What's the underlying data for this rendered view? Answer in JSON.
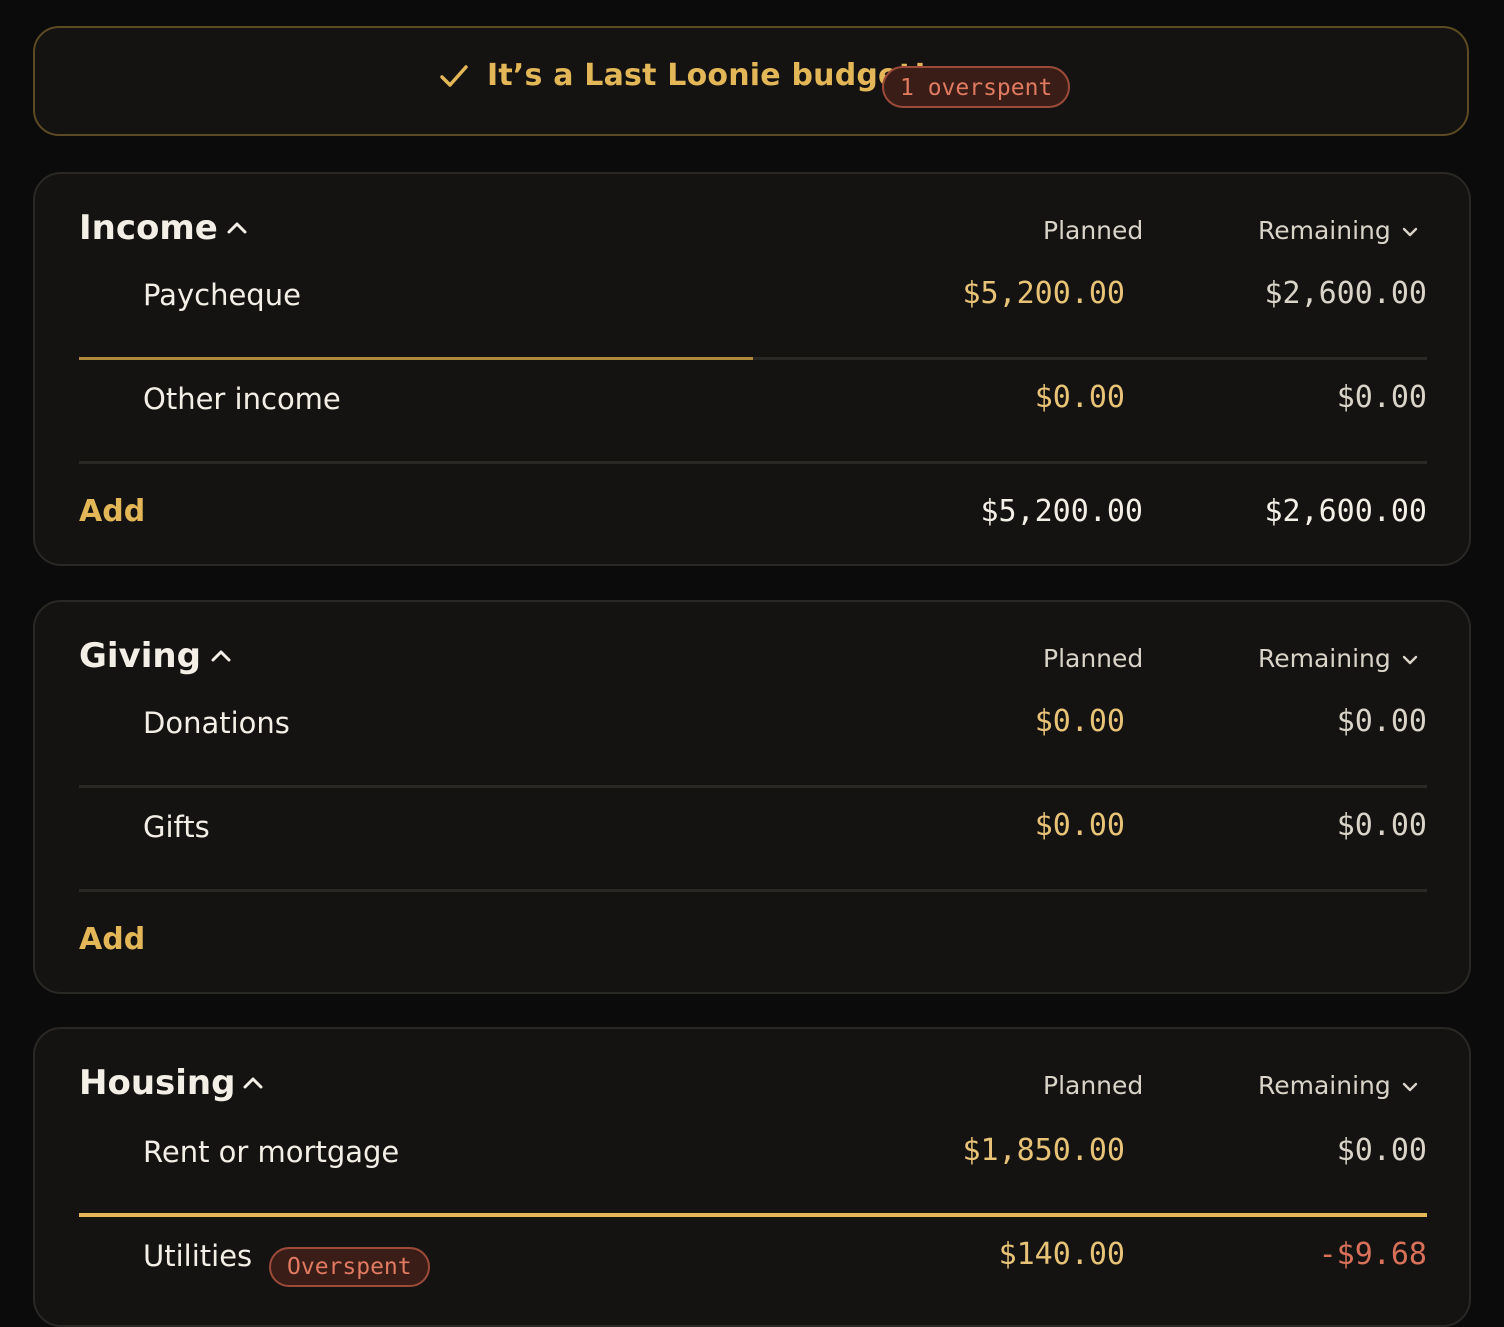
{
  "banner": {
    "icon": "check-icon",
    "title": "It’s a Last Loonie budget!",
    "badge": "1 overspent",
    "accent": "#e3b758"
  },
  "columns": {
    "planned": "Planned",
    "remaining": "Remaining"
  },
  "groups": [
    {
      "name": "Income",
      "rows": [
        {
          "label": "Paycheque",
          "planned": "$5,200.00",
          "remaining": "$2,600.00",
          "progress": 0.5
        },
        {
          "label": "Other income",
          "planned": "$0.00",
          "remaining": "$0.00",
          "progress": 0
        }
      ],
      "add_label": "Add",
      "total_planned": "$5,200.00",
      "total_remaining": "$2,600.00"
    },
    {
      "name": "Giving",
      "rows": [
        {
          "label": "Donations",
          "planned": "$0.00",
          "remaining": "$0.00",
          "progress": 0
        },
        {
          "label": "Gifts",
          "planned": "$0.00",
          "remaining": "$0.00",
          "progress": 0
        }
      ],
      "add_label": "Add"
    },
    {
      "name": "Housing",
      "rows": [
        {
          "label": "Rent or mortgage",
          "planned": "$1,850.00",
          "remaining": "$0.00",
          "progress": 1
        },
        {
          "label": "Utilities",
          "badge": "Overspent",
          "planned": "$140.00",
          "remaining": "-$9.68",
          "progress": 1
        }
      ]
    }
  ],
  "colors": {
    "background": "#0b0b0b",
    "card": "#141312",
    "accent": "#e3b758",
    "planned": "#e8c377",
    "negative": "#d9715a"
  }
}
